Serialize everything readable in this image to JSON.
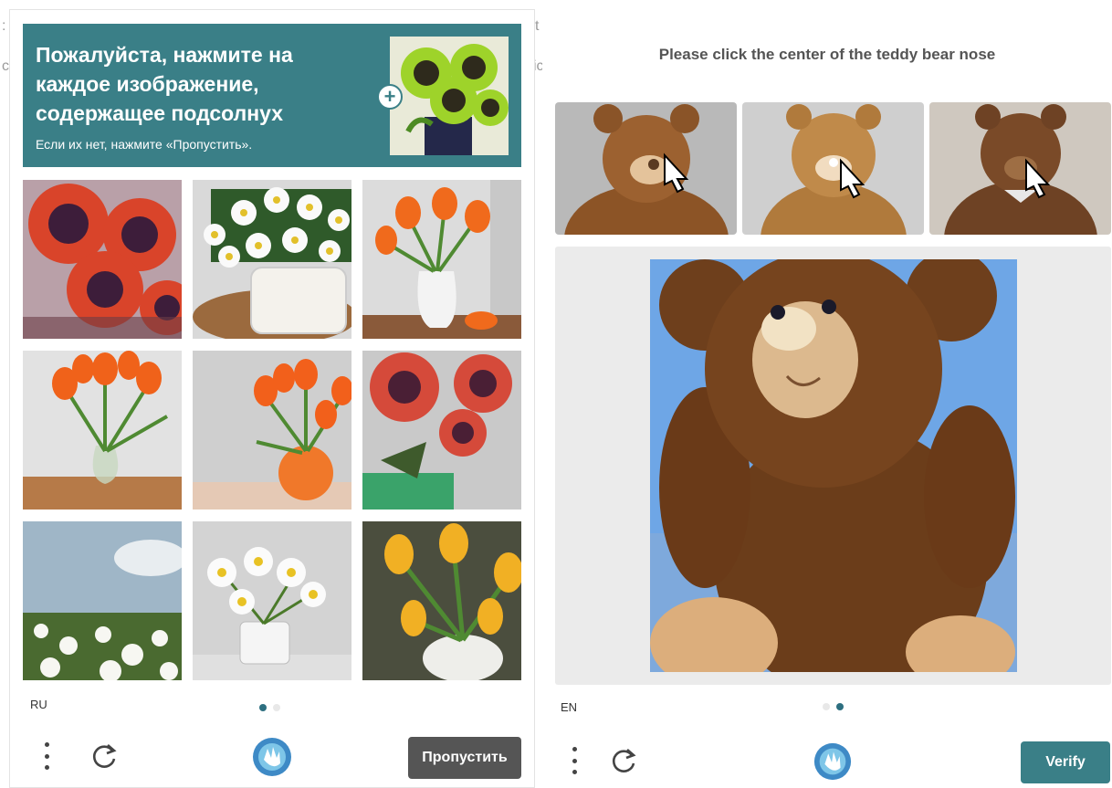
{
  "left_widget": {
    "prompt_main": "Пожалуйста, нажмите на каждое изображение, содержащее подсолнух",
    "prompt_sub": "Если их нет, нажмите «Пропустить».",
    "example_icon": "plus-icon",
    "tiles": [
      {
        "subject": "sunflowers"
      },
      {
        "subject": "daisies-in-white-pot"
      },
      {
        "subject": "orange-tulips-in-vase"
      },
      {
        "subject": "orange-tulips-in-glass-vase"
      },
      {
        "subject": "tulips-in-orange-vase"
      },
      {
        "subject": "red-sunflowers-in-green-pot"
      },
      {
        "subject": "daisy-field"
      },
      {
        "subject": "daisies-in-pot"
      },
      {
        "subject": "yellow-tulips"
      }
    ],
    "language": "RU",
    "pages": 2,
    "active_page": 1,
    "skip_label": "Пропустить",
    "skip_color": "#555555"
  },
  "right_widget": {
    "instruction": "Please click the center of the teddy bear nose",
    "examples": [
      {
        "subject": "teddy-bear-pointer-nose"
      },
      {
        "subject": "teddy-bear-pointer-nose"
      },
      {
        "subject": "teddy-bear-pointer-nose"
      }
    ],
    "task_image": "teddy-bear",
    "language": "EN",
    "pages": 2,
    "active_page": 2,
    "verify_label": "Verify",
    "verify_color": "#3a7f87"
  },
  "background_residue": [
    "t",
    "ic",
    ":",
    "c"
  ],
  "colors": {
    "accent": "#3a7f87",
    "dot_active": "#2d6f80"
  }
}
